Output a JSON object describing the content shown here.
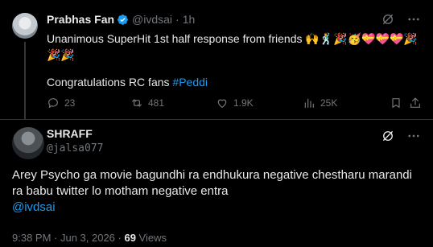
{
  "tweet1": {
    "author_name": "Prabhas Fan",
    "handle": "@ivdsai",
    "separator": "·",
    "time": "1h",
    "text_line1": "Unanimous SuperHit 1st half response from friends 🙌🕺🎉🥳💝💝💝🎉",
    "text_line2": "🎉🎉",
    "text_line3_prefix": "Congratulations RC fans ",
    "hashtag": "#Peddi",
    "replies": "23",
    "reposts": "481",
    "likes": "1.9K",
    "views": "25K"
  },
  "tweet2": {
    "author_name": "SHRAFF",
    "handle": "@jalsa077",
    "text": "Arey Psycho ga movie bagundhi ra endhukura negative chestharu marandi ra babu twitter lo motham negative entra",
    "mention": "@ivdsai",
    "timestamp": "9:38 PM · Jun 3, 2026 · ",
    "views_count": "69",
    "views_label": " Views"
  },
  "colors": {
    "background": "#000000",
    "text_primary": "#e7e9ea",
    "text_secondary": "#71767b",
    "link": "#1d9bf0",
    "divider": "#2f3336"
  },
  "icons": [
    "verified-badge-icon",
    "grok-icon",
    "more-icon",
    "reply-icon",
    "repost-icon",
    "like-icon",
    "views-icon",
    "bookmark-icon",
    "share-icon"
  ]
}
